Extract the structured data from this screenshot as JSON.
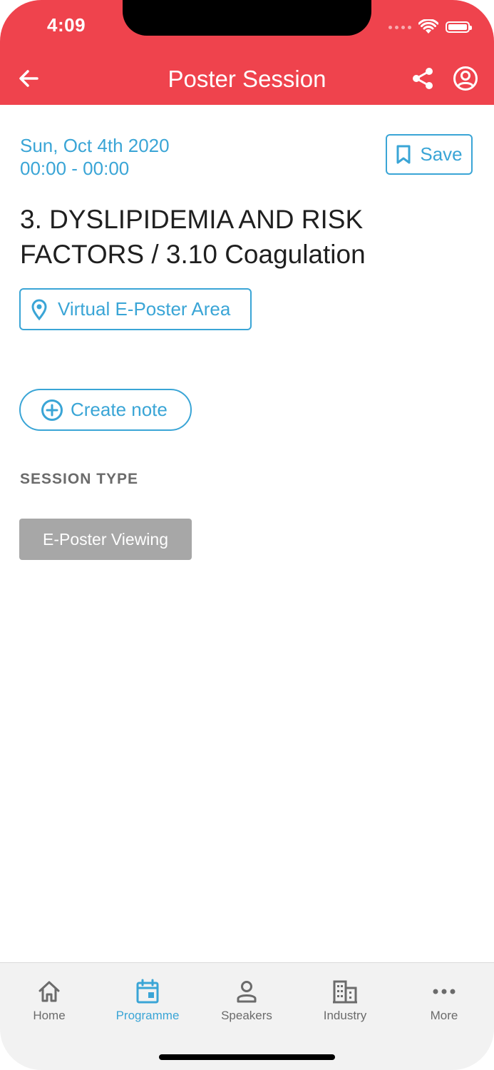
{
  "status_bar": {
    "time": "4:09"
  },
  "header": {
    "title": "Poster Session",
    "back_icon": "arrow-left-icon",
    "share_icon": "share-icon",
    "profile_icon": "user-circle-icon"
  },
  "session": {
    "date": "Sun, Oct 4th 2020",
    "time": "00:00 - 00:00",
    "title": "3. DYSLIPIDEMIA AND RISK FACTORS / 3.10 Coagulation",
    "location": "Virtual E-Poster Area",
    "save_label": "Save",
    "create_note_label": "Create note",
    "session_type_heading": "SESSION TYPE",
    "session_type": "E-Poster Viewing"
  },
  "tabbar": {
    "items": [
      {
        "label": "Home",
        "icon": "home-icon",
        "active": false
      },
      {
        "label": "Programme",
        "icon": "calendar-icon",
        "active": true
      },
      {
        "label": "Speakers",
        "icon": "person-icon",
        "active": false
      },
      {
        "label": "Industry",
        "icon": "building-icon",
        "active": false
      },
      {
        "label": "More",
        "icon": "more-dots-icon",
        "active": false
      }
    ]
  },
  "colors": {
    "header": "#ef434d",
    "accent": "#3aa5d6",
    "tag_bg": "#a7a7a7"
  }
}
